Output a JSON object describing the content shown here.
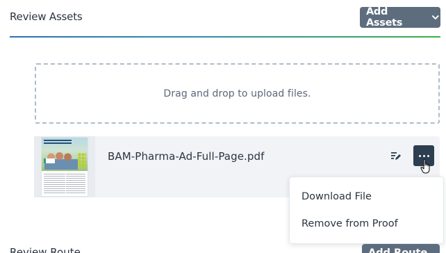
{
  "review_assets": {
    "title": "Review Assets",
    "add_button_label": "Add Assets",
    "dropzone_text": "Drag and drop to upload files."
  },
  "asset": {
    "filename": "BAM-Pharma-Ad-Full-Page.pdf",
    "actions": [
      "edit-icon",
      "more-options-icon"
    ]
  },
  "context_menu": {
    "items": [
      {
        "label": "Download File"
      },
      {
        "label": "Remove from Proof"
      }
    ]
  },
  "review_route": {
    "title": "Review Route",
    "add_button_label": "Add Route"
  },
  "colors": {
    "button": "#5d6d7e",
    "more_button": "#2c3e50",
    "divider_start": "#2f6fb5",
    "divider_end": "#3fae4a"
  }
}
